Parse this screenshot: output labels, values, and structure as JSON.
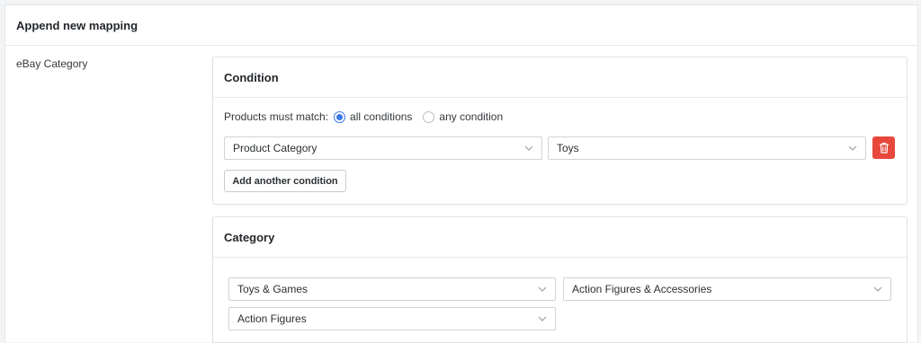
{
  "panel": {
    "title": "Append new mapping"
  },
  "left_label": "eBay Category",
  "condition": {
    "title": "Condition",
    "match_label": "Products must match:",
    "options": [
      {
        "label": "all conditions",
        "checked": true
      },
      {
        "label": "any condition",
        "checked": false
      }
    ],
    "rule": {
      "field": "Product Category",
      "value": "Toys"
    },
    "delete_icon": "trash-icon",
    "add_button": "Add another condition",
    "delete_color": "#e8483b",
    "accent_color": "#3b78e7"
  },
  "category": {
    "title": "Category",
    "selects": [
      "Toys & Games",
      "Action Figures & Accessories",
      "Action Figures"
    ]
  }
}
